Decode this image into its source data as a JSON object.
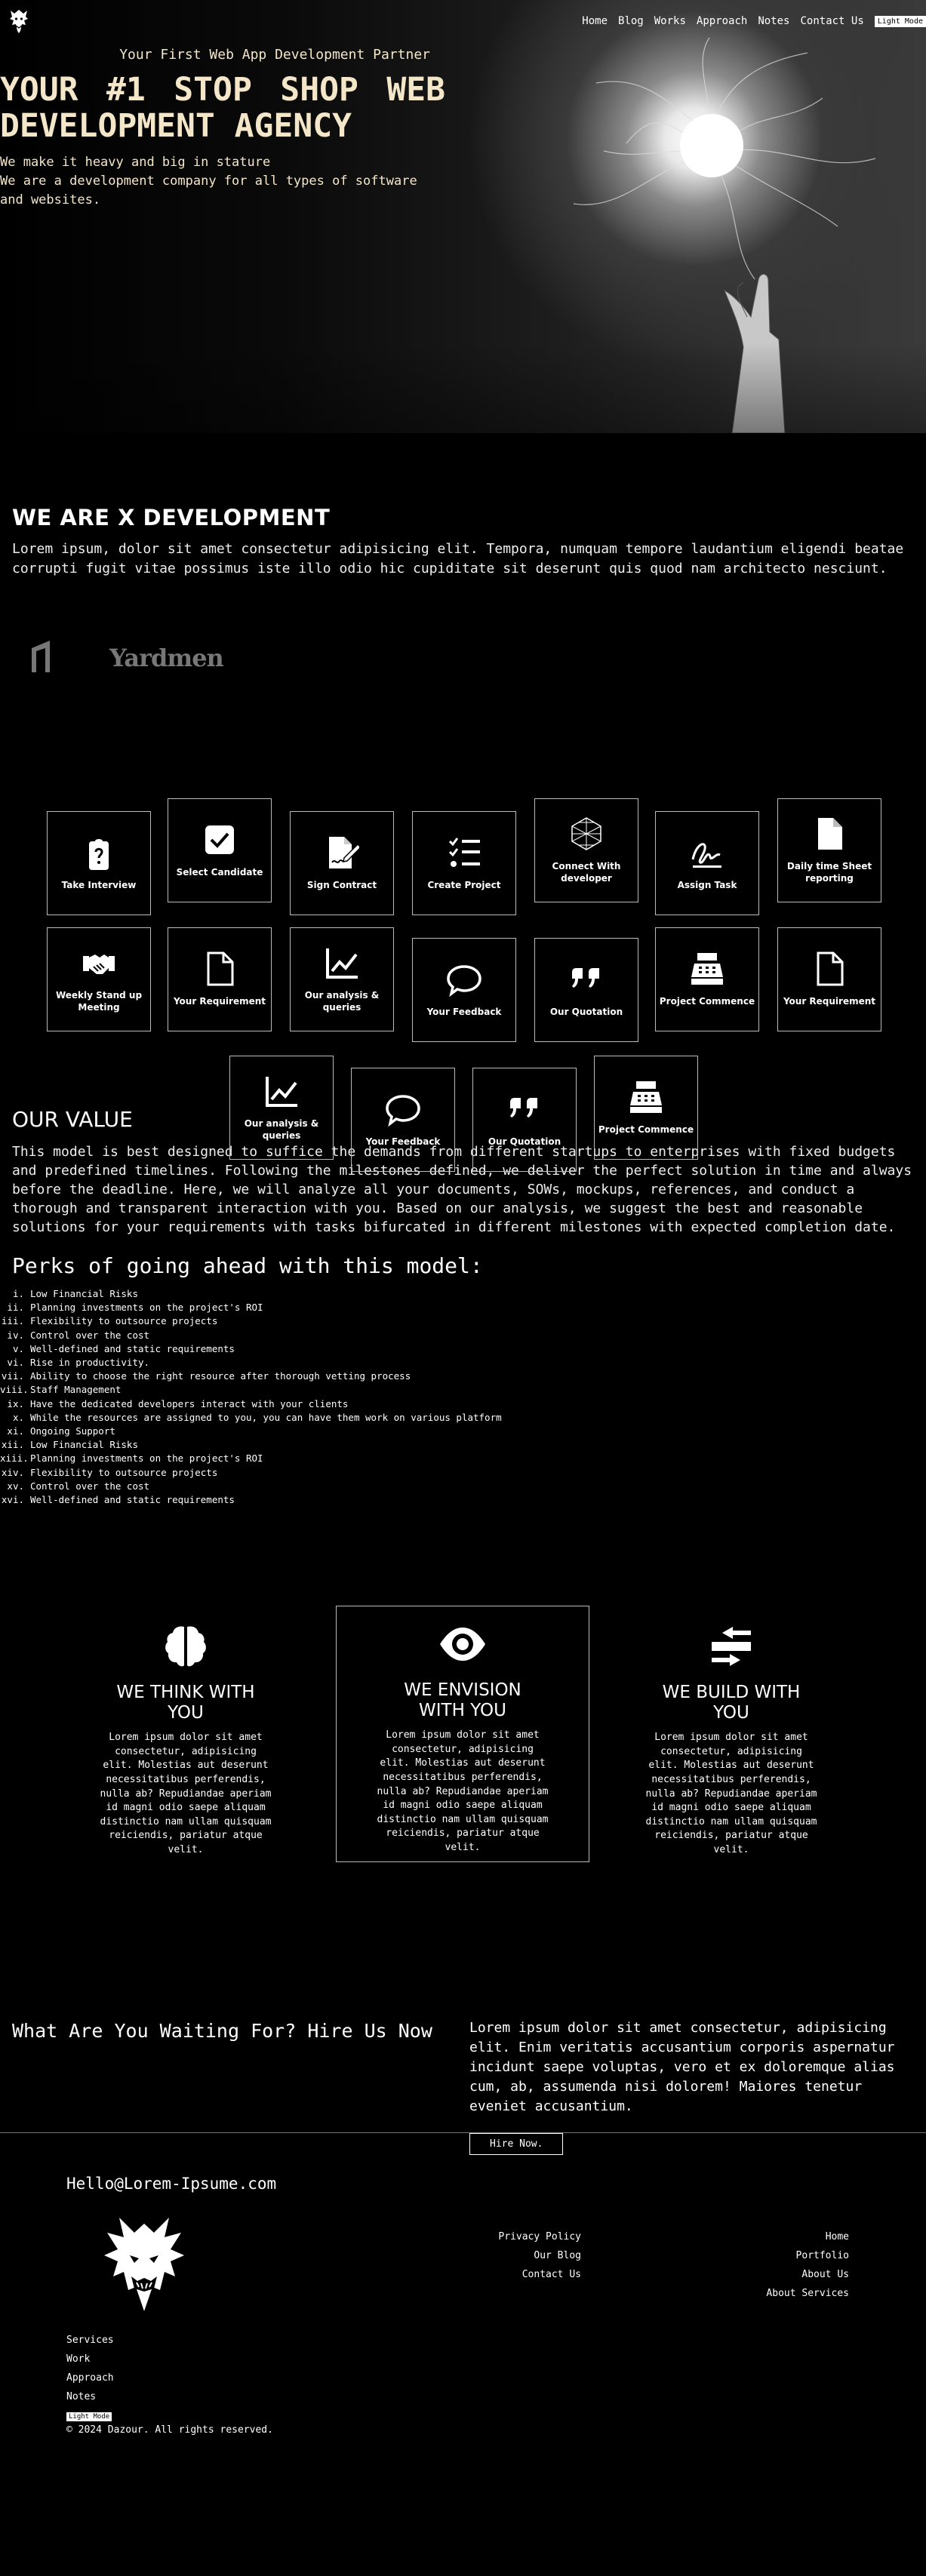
{
  "nav": {
    "links": [
      "Home",
      "Blog",
      "Works",
      "Approach",
      "Notes",
      "Contact Us"
    ],
    "light_mode": "Light Mode"
  },
  "hero": {
    "tagline": "Your First Web App Development Partner",
    "title": "YOUR #1 STOP SHOP WEB DEVELOPMENT AGENCY",
    "sub1": "We make it heavy and big in stature",
    "sub2": "We are a development company for all types of software and websites."
  },
  "about": {
    "title": "WE ARE X DEVELOPMENT",
    "text": "Lorem ipsum, dolor sit amet consectetur adipisicing elit. Tempora, numquam tempore laudantium eligendi beatae corrupti fugit vitae possimus iste illo odio hic cupiditate sit deserunt quis quod nam architecto nesciunt."
  },
  "partners": {
    "yardmen": "Yardmen"
  },
  "process": [
    {
      "label": "Take Interview",
      "icon": "clipboard-question-icon"
    },
    {
      "label": "Select Candidate",
      "icon": "check-square-icon"
    },
    {
      "label": "Sign Contract",
      "icon": "file-signature-icon"
    },
    {
      "label": "Create Project",
      "icon": "list-check-icon"
    },
    {
      "label": "Connect With developer",
      "icon": "hexagon-mesh-icon"
    },
    {
      "label": "Assign Task",
      "icon": "signature-icon"
    },
    {
      "label": "Daily time Sheet reporting",
      "icon": "file-icon"
    },
    {
      "label": "Weekly Stand up Meeting",
      "icon": "handshake-icon"
    },
    {
      "label": "Your Requirement",
      "icon": "file-outline-icon"
    },
    {
      "label": "Our analysis & queries",
      "icon": "chart-line-icon"
    },
    {
      "label": "Your Feedback",
      "icon": "comment-icon"
    },
    {
      "label": "Our Quotation",
      "icon": "quote-icon"
    },
    {
      "label": "Project Commence",
      "icon": "cash-register-icon"
    },
    {
      "label": "Your Requirement",
      "icon": "file-outline-icon"
    },
    {
      "label": "Our analysis & queries",
      "icon": "chart-line-icon"
    },
    {
      "label": "Your Feedback",
      "icon": "comment-icon"
    },
    {
      "label": "Our Quotation",
      "icon": "quote-icon"
    },
    {
      "label": "Project Commence",
      "icon": "cash-register-icon"
    }
  ],
  "value": {
    "title": "OUR VALUE",
    "text": "This model is best designed to suffice the demands from different startups to enterprises with fixed budgets and predefined timelines. Following the milestones defined, we deliver the perfect solution in time and always before the deadline. Here, we will analyze all your documents, SOWs, mockups, references, and conduct a thorough and transparent interaction with you. Based on our analysis, we suggest the best and reasonable solutions for your requirements with tasks bifurcated in different milestones with expected completion date.",
    "perks_title": "Perks of going ahead with this model:",
    "perks": [
      {
        "n": "i.",
        "t": "Low Financial Risks"
      },
      {
        "n": "ii.",
        "t": "Planning investments on the project's ROI"
      },
      {
        "n": "iii.",
        "t": "Flexibility to outsource projects"
      },
      {
        "n": "iv.",
        "t": "Control over the cost"
      },
      {
        "n": "v.",
        "t": "Well-defined and static requirements"
      },
      {
        "n": "vi.",
        "t": "Rise in productivity."
      },
      {
        "n": "vii.",
        "t": "Ability to choose the right resource after thorough vetting process"
      },
      {
        "n": "viii.",
        "t": "Staff Management"
      },
      {
        "n": "ix.",
        "t": "Have the dedicated developers interact with your clients"
      },
      {
        "n": "x.",
        "t": "While the resources are assigned to you, you can have them work on various platform"
      },
      {
        "n": "xi.",
        "t": "Ongoing Support"
      },
      {
        "n": "xii.",
        "t": "Low Financial Risks"
      },
      {
        "n": "xiii.",
        "t": "Planning investments on the project's ROI"
      },
      {
        "n": "xiv.",
        "t": "Flexibility to outsource projects"
      },
      {
        "n": "xv.",
        "t": "Control over the cost"
      },
      {
        "n": "xvi.",
        "t": "Well-defined and static requirements"
      }
    ]
  },
  "pillars": [
    {
      "title": "WE THINK WITH YOU",
      "icon": "brain-icon",
      "text": "Lorem ipsum dolor sit amet consectetur, adipisicing elit. Molestias aut deserunt necessitatibus perferendis, nulla ab? Repudiandae aperiam id magni odio saepe aliquam distinctio nam ullam quisquam reiciendis, pariatur atque velit."
    },
    {
      "title": "WE ENVISION WITH YOU",
      "icon": "eye-icon",
      "text": "Lorem ipsum dolor sit amet consectetur, adipisicing elit. Molestias aut deserunt necessitatibus perferendis, nulla ab? Repudiandae aperiam id magni odio saepe aliquam distinctio nam ullam quisquam reiciendis, pariatur atque velit."
    },
    {
      "title": "WE BUILD WITH YOU",
      "icon": "build-arrows-icon",
      "text": "Lorem ipsum dolor sit amet consectetur, adipisicing elit. Molestias aut deserunt necessitatibus perferendis, nulla ab? Repudiandae aperiam id magni odio saepe aliquam distinctio nam ullam quisquam reiciendis, pariatur atque velit."
    }
  ],
  "cta": {
    "title": "What Are You Waiting For? Hire Us Now",
    "text": "Lorem ipsum dolor sit amet consectetur, adipisicing elit. Enim veritatis accusantium corporis aspernatur incidunt saepe voluptas, vero et ex doloremque alias cum, ab, assumenda nisi dolorem! Maiores tenetur eveniet accusantium.",
    "button": "Hire Now."
  },
  "footer": {
    "email": "Hello@Lorem-Ipsume.com",
    "mid_links": [
      "Privacy Policy",
      "Our Blog",
      "Contact Us"
    ],
    "right_links": [
      "Home",
      "Portfolio",
      "About Us",
      "About Services"
    ],
    "bottom_links": [
      "Services",
      "Work",
      "Approach",
      "Notes"
    ],
    "light_mode": "Light Mode",
    "copyright": "© 2024 Dazour. All rights reserved."
  }
}
